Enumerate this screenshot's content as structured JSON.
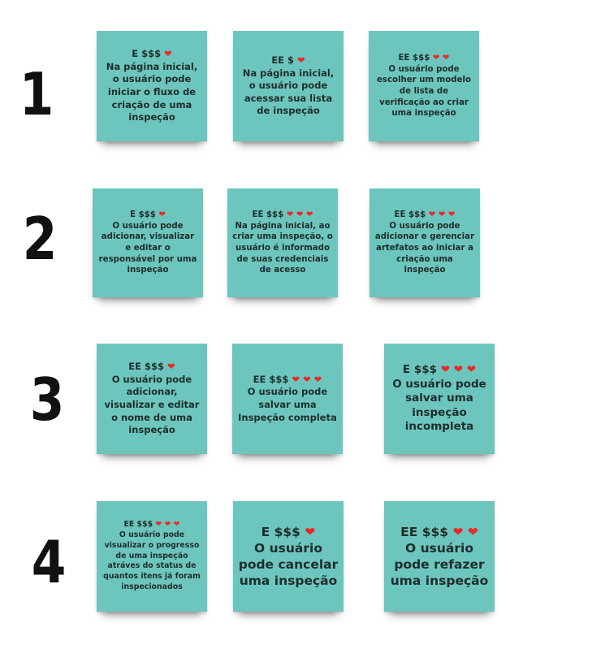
{
  "row_labels": [
    "1",
    "2",
    "3",
    "4"
  ],
  "colors": {
    "note": "#6cc6bd",
    "heart": "#e8282b",
    "text": "#1f2d2c"
  },
  "notes": [
    {
      "header": "E $$$",
      "hearts": "❤",
      "text": "Na página inicial, o usuário pode iniciar o fluxo de criação de uma inspeção"
    },
    {
      "header": "EE $",
      "hearts": "❤",
      "text": "Na página inicial, o usuário pode acessar sua lista de inspeção"
    },
    {
      "header": "EE $$$",
      "hearts": "❤ ❤",
      "text": "O usuário pode escolher um modelo de lista de verificação ao criar uma inspeção"
    },
    {
      "header": "E $$$",
      "hearts": "❤",
      "text": "O usuário pode adicionar, visualizar e editar o responsável por uma inspeção"
    },
    {
      "header": "EE $$$",
      "hearts": "❤ ❤ ❤",
      "text": "Na página inicial, ao criar uma inspeção, o usuário é informado de suas credenciais de acesso"
    },
    {
      "header": "EE $$$",
      "hearts": "❤ ❤ ❤",
      "text": "O usuário pode adicionar e gerenciar artefatos ao iniciar a criação uma inspeção"
    },
    {
      "header": "EE $$$",
      "hearts": "❤",
      "text": "O usuário pode adicionar, visualizar e editar o nome de uma inspeção"
    },
    {
      "header": "EE $$$",
      "hearts": "❤ ❤ ❤",
      "text": "O usuário pode salvar uma Inspeção completa"
    },
    {
      "header": "E $$$",
      "hearts": "❤ ❤ ❤",
      "text": "O usuário pode salvar uma inspeção incompleta"
    },
    {
      "header": "EE $$$",
      "hearts": "❤ ❤ ❤",
      "text": "O usuário pode visualizar o progresso de uma inspeção atráves do status de quantos itens já foram inspecionados"
    },
    {
      "header": "E $$$",
      "hearts": "❤",
      "text": "O usuário pode cancelar uma inspeção"
    },
    {
      "header": "EE $$$",
      "hearts": "❤ ❤",
      "text": "O usuário pode refazer uma inspeção"
    }
  ]
}
